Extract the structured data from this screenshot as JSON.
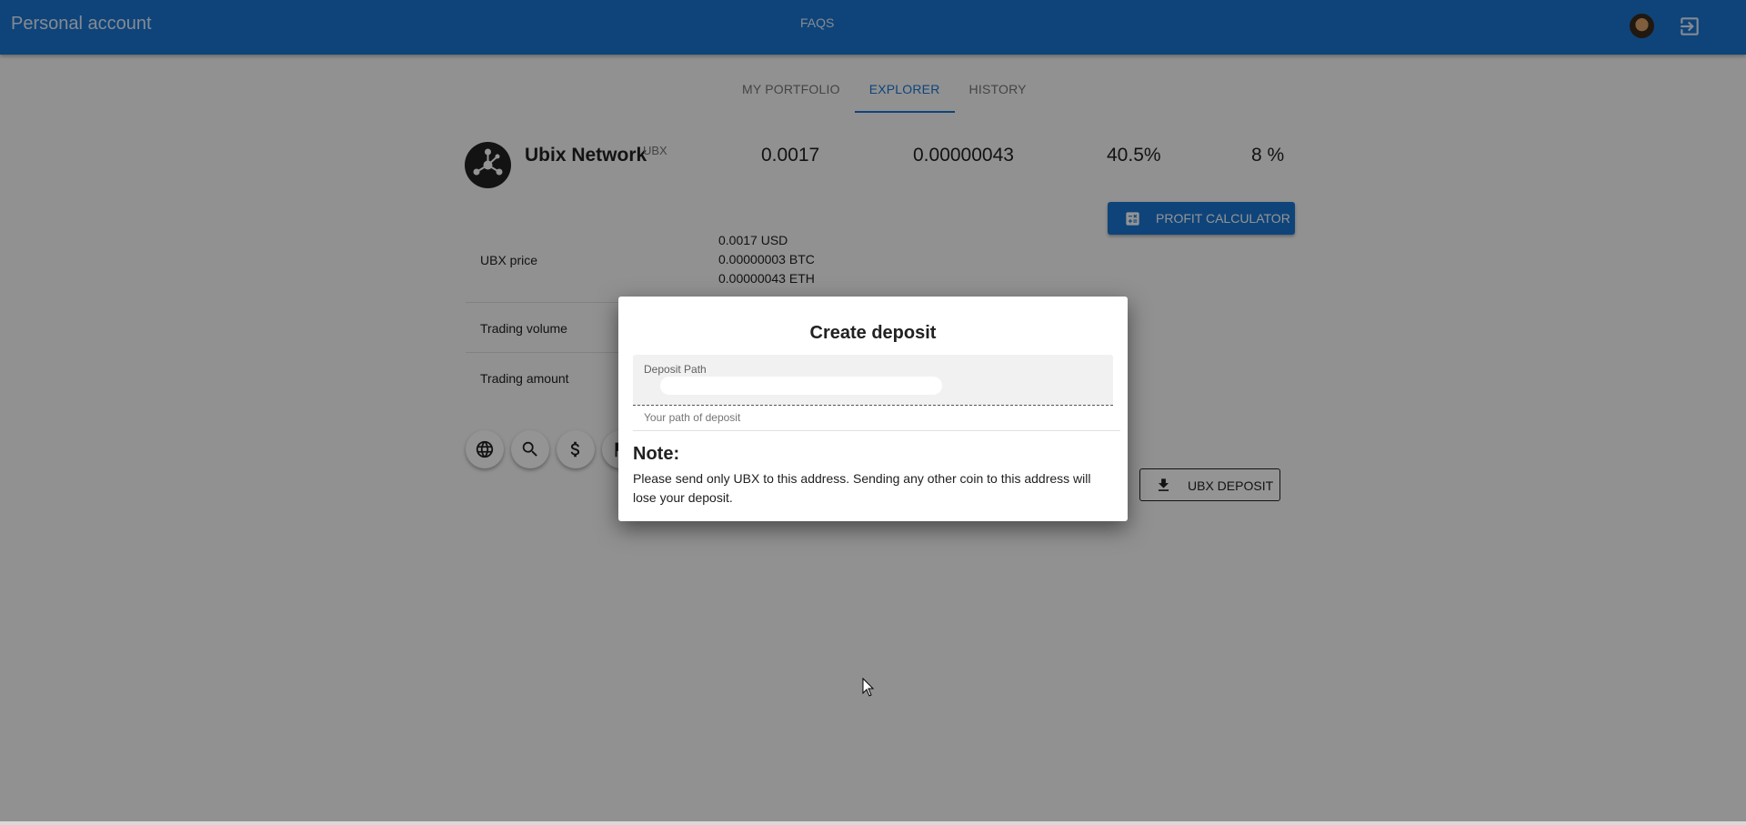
{
  "header": {
    "title": "Personal account",
    "faqs_label": "FAQS",
    "avatar_icon": "user-avatar",
    "logout_icon": "logout-icon"
  },
  "tabs": [
    {
      "label": "MY PORTFOLIO",
      "active": false
    },
    {
      "label": "EXPLORER",
      "active": true
    },
    {
      "label": "HISTORY",
      "active": false
    }
  ],
  "coin": {
    "name": "Ubix Network",
    "ticker": "UBX",
    "stats": [
      "0.0017",
      "0.00000043",
      "40.5%",
      "8 %"
    ]
  },
  "buttons": {
    "profit_calculator": "PROFIT CALCULATOR",
    "ubx_deposit": "UBX DEPOSIT"
  },
  "info": {
    "price_label": "UBX price",
    "price_values": [
      "0.0017 USD",
      "0.00000003 BTC",
      "0.00000043 ETH"
    ],
    "volume_label": "Trading volume",
    "amount_label": "Trading amount"
  },
  "actions": [
    "globe-icon",
    "search-icon",
    "dollar-icon",
    "flag-icon"
  ],
  "dialog": {
    "title": "Create deposit",
    "field_label": "Deposit Path",
    "field_value": "",
    "field_hint": "Your path of deposit",
    "note_heading": "Note:",
    "note_text": "Please send only UBX to this address. Sending any other coin to this address will lose your deposit."
  },
  "colors": {
    "primary": "#1976d2",
    "overlay": "rgba(0,0,0,0.42)"
  }
}
